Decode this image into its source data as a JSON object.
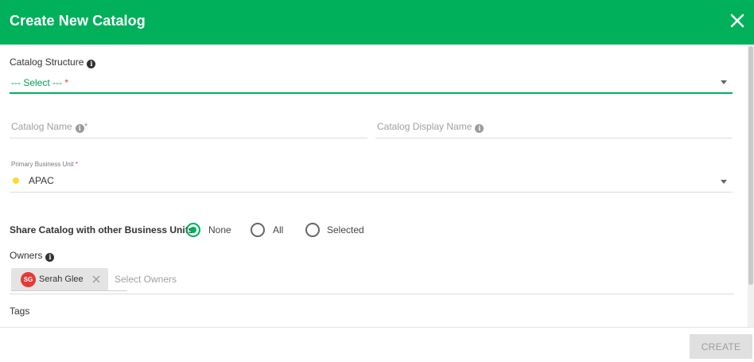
{
  "dialog": {
    "title": "Create New Catalog"
  },
  "form": {
    "catalog_structure": {
      "label": "Catalog Structure",
      "value": "--- Select ---",
      "required_mark": "*"
    },
    "catalog_name": {
      "placeholder": "Catalog Name",
      "required_mark": "*"
    },
    "catalog_display_name": {
      "placeholder": "Catalog Display Name"
    },
    "primary_business_unit": {
      "label": "Primary Business Unit",
      "required_mark": "*",
      "value": "APAC",
      "dot_color": "#fdd835"
    },
    "share": {
      "label": "Share Catalog with other Business Units",
      "options": [
        "None",
        "All",
        "Selected"
      ],
      "selected": "None"
    },
    "owners": {
      "label": "Owners",
      "chips": [
        {
          "initials": "SG",
          "name": "Serah Glee",
          "avatar_color": "#e53935"
        }
      ],
      "placeholder": "Select Owners"
    },
    "tags": {
      "label": "Tags"
    }
  },
  "footer": {
    "create_label": "CREATE"
  },
  "colors": {
    "brand": "#00b05b",
    "required": "#e53935",
    "disabled_bg": "#e0e0e0"
  }
}
